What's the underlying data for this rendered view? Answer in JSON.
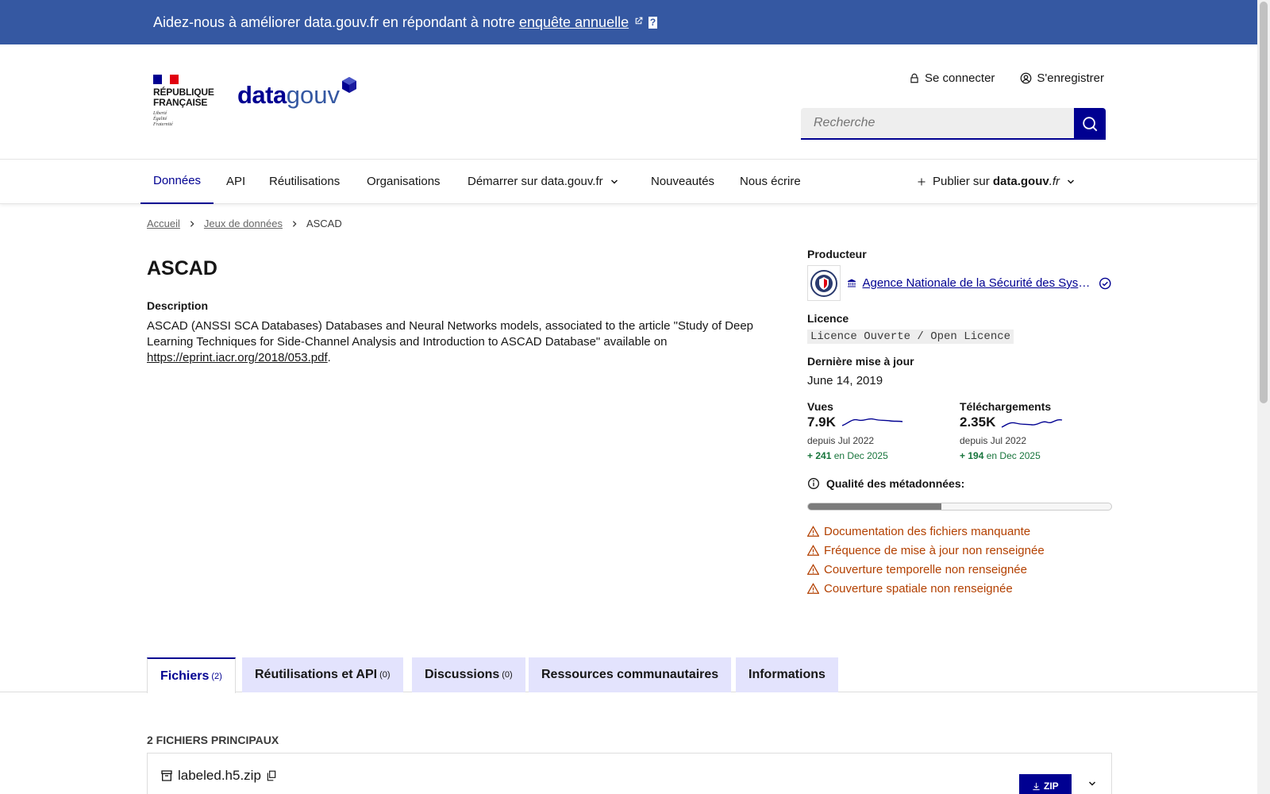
{
  "banner": {
    "text": "Aidez-nous à améliorer data.gouv.fr en répondant à notre",
    "link": "enquête annuelle",
    "help": "?"
  },
  "header": {
    "republique_line1": "RÉPUBLIQUE",
    "republique_line2": "FRANÇAISE",
    "motto1": "Liberté",
    "motto2": "Égalité",
    "motto3": "Fraternité",
    "logo_data": "data",
    "logo_gouv": "gouv",
    "login": "Se connecter",
    "register": "S'enregistrer",
    "search_placeholder": "Recherche"
  },
  "nav": {
    "items": [
      "Données",
      "API",
      "Réutilisations",
      "Organisations",
      "Démarrer sur data.gouv.fr",
      "Nouveautés",
      "Nous écrire"
    ],
    "publish_prefix": "Publier sur",
    "publish_brand": "data.gouv",
    "publish_suffix": ".fr"
  },
  "breadcrumb": [
    "Accueil",
    "Jeux de données",
    "ASCAD"
  ],
  "dataset": {
    "title": "ASCAD",
    "description_label": "Description",
    "description": "ASCAD (ANSSI SCA Databases) Databases and Neural Networks models, associated to the article \"Study of Deep Learning Techniques for Side-Channel Analysis and Introduction to ASCAD Database\" available on",
    "description_link": "https://eprint.iacr.org/2018/053.pdf",
    "description_end": "."
  },
  "aside": {
    "producer_label": "Producteur",
    "producer_name": "Agence Nationale de la Sécurité des Systèmes d'Information",
    "licence_label": "Licence",
    "licence": "Licence Ouverte / Open Licence",
    "updated_label": "Dernière mise à jour",
    "updated": "June 14, 2019",
    "views_label": "Vues",
    "views": "7.9K",
    "views_since": "depuis Jul 2022",
    "views_delta": "+ 241",
    "views_delta_period": "en Dec 2025",
    "downloads_label": "Téléchargements",
    "downloads": "2.35K",
    "downloads_since": "depuis Jul 2022",
    "downloads_delta": "+ 194",
    "downloads_delta_period": "en Dec 2025",
    "quality_label": "Qualité des métadonnées:",
    "quality_fraction": 0.44,
    "warnings": [
      "Documentation des fichiers manquante",
      "Fréquence de mise à jour non renseignée",
      "Couverture temporelle non renseignée",
      "Couverture spatiale non renseignée"
    ]
  },
  "tabs": [
    {
      "label": "Fichiers",
      "count": "(2)"
    },
    {
      "label": "Réutilisations et API",
      "count": "(0)"
    },
    {
      "label": "Discussions",
      "count": "(0)"
    },
    {
      "label": "Ressources communautaires",
      "count": ""
    },
    {
      "label": "Informations",
      "count": ""
    }
  ],
  "files": {
    "title": "2 FICHIERS PRINCIPAUX",
    "first_name": "labeled.h5.zip",
    "first_format": "ZIP"
  },
  "colors": {
    "primary": "#000091",
    "banner": "#3558a2",
    "warning": "#b34000",
    "success": "#18753c"
  }
}
